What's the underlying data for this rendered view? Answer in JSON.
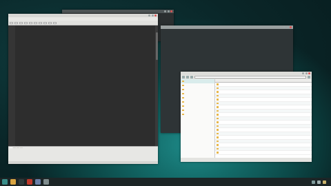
{
  "colors": {
    "desktop_teal": "#136b69",
    "editor_bg": "#2d2d2d",
    "terminal_bg": "#2e3436",
    "comment_green": "#8aa46b",
    "keyword_yellow": "#e0c070",
    "folder_orange": "#e7b64a",
    "close_red": "#dd5555"
  },
  "back_window": {
    "title": ""
  },
  "editor": {
    "title": "",
    "menu": [
      "",
      "",
      "",
      "",
      "",
      "",
      "",
      "",
      "",
      "",
      "",
      ""
    ],
    "toolbar": [
      "",
      "",
      "",
      "",
      "",
      "",
      "",
      "",
      "",
      ""
    ],
    "line_numbers": [
      "",
      "",
      "",
      "",
      "",
      "",
      "",
      "",
      "",
      "",
      "",
      "",
      "",
      "",
      "",
      "",
      "",
      "",
      "",
      "",
      "",
      "",
      "",
      "",
      "",
      "",
      "",
      "",
      "",
      "",
      "",
      "",
      "",
      "",
      "",
      "",
      "",
      "",
      "",
      "",
      ""
    ],
    "code_lines": [
      {
        "text": "",
        "cls": "c-comment"
      },
      {
        "text": "",
        "cls": "c-comment"
      },
      {
        "text": "",
        "cls": "c-comment"
      },
      {
        "text": "",
        "cls": "c-comment"
      },
      {
        "text": "",
        "cls": "c-comment"
      },
      {
        "text": "",
        "cls": "c-comment"
      },
      {
        "text": "",
        "cls": "c-comment"
      },
      {
        "text": "",
        "cls": "c-plain"
      },
      {
        "text": "",
        "cls": "c-plain"
      },
      {
        "text": "",
        "cls": "c-keyword"
      },
      {
        "text": "",
        "cls": "c-keyword"
      },
      {
        "text": "",
        "cls": "c-plain"
      },
      {
        "text": "",
        "cls": "c-plain"
      },
      {
        "text": "",
        "cls": "c-plain"
      },
      {
        "text": "",
        "cls": "c-keyword"
      },
      {
        "text": "",
        "cls": "c-keyword"
      },
      {
        "text": "",
        "cls": "c-plain"
      },
      {
        "text": "",
        "cls": "c-plain"
      },
      {
        "text": "",
        "cls": "c-keyword"
      },
      {
        "text": "",
        "cls": "c-keyword"
      },
      {
        "text": "",
        "cls": "c-plain"
      },
      {
        "text": "",
        "cls": "c-plain"
      },
      {
        "text": "",
        "cls": "c-keyword"
      },
      {
        "text": "",
        "cls": "c-plain"
      },
      {
        "text": "",
        "cls": "c-keyword"
      },
      {
        "text": "",
        "cls": "c-plain"
      },
      {
        "text": "",
        "cls": "c-plain"
      },
      {
        "text": "",
        "cls": "c-fn"
      },
      {
        "text": "",
        "cls": "c-fn"
      },
      {
        "text": "",
        "cls": "c-fn"
      },
      {
        "text": "",
        "cls": "c-fn"
      },
      {
        "text": "",
        "cls": "c-plain"
      },
      {
        "text": "",
        "cls": "c-plain"
      },
      {
        "text": "",
        "cls": "c-plain"
      },
      {
        "text": "",
        "cls": "c-fn"
      },
      {
        "text": "",
        "cls": "c-fn"
      },
      {
        "text": "",
        "cls": "c-fn"
      },
      {
        "text": "",
        "cls": "c-fn"
      },
      {
        "text": "",
        "cls": "c-plain"
      },
      {
        "text": "",
        "cls": "c-plain"
      }
    ],
    "bottom_tabs": [
      "",
      "",
      "",
      ""
    ],
    "messages": [
      "",
      ""
    ],
    "status": ""
  },
  "terminal": {
    "title": "",
    "lines": [
      {
        "text": "",
        "cls": ""
      },
      {
        "text": "",
        "cls": ""
      },
      {
        "text": "",
        "cls": ""
      },
      {
        "text": "",
        "cls": ""
      },
      {
        "text": "",
        "cls": ""
      },
      {
        "text": "",
        "cls": ""
      },
      {
        "text": "",
        "cls": ""
      },
      {
        "text": "",
        "cls": ""
      },
      {
        "text": "",
        "cls": ""
      },
      {
        "text": "",
        "cls": ""
      },
      {
        "text": "",
        "cls": ""
      },
      {
        "text": "",
        "cls": ""
      },
      {
        "text": "",
        "cls": ""
      },
      {
        "text": "",
        "cls": ""
      },
      {
        "text": "",
        "cls": ""
      },
      {
        "text": "",
        "cls": ""
      },
      {
        "text": "",
        "cls": ""
      },
      {
        "text": "",
        "cls": "t-green"
      },
      {
        "text": "",
        "cls": "t-green"
      },
      {
        "text": "",
        "cls": "t-green"
      },
      {
        "text": "",
        "cls": "t-blue"
      },
      {
        "text": "",
        "cls": "t-blue"
      },
      {
        "text": "",
        "cls": ""
      },
      {
        "text": "",
        "cls": ""
      }
    ]
  },
  "file_manager": {
    "title": "",
    "path": "",
    "tree": [
      {
        "label": "",
        "selected": true
      },
      {
        "label": "",
        "selected": false
      },
      {
        "label": "",
        "selected": false
      },
      {
        "label": "",
        "selected": false
      },
      {
        "label": "",
        "selected": false
      },
      {
        "label": "",
        "selected": false
      },
      {
        "label": "",
        "selected": false
      },
      {
        "label": "",
        "selected": false
      },
      {
        "label": "",
        "selected": false
      }
    ],
    "columns": [
      "",
      "",
      ""
    ],
    "rows": [
      {
        "name": "",
        "size": "",
        "type": ""
      },
      {
        "name": "",
        "size": "",
        "type": ""
      },
      {
        "name": "",
        "size": "",
        "type": ""
      },
      {
        "name": "",
        "size": "",
        "type": ""
      },
      {
        "name": "",
        "size": "",
        "type": ""
      },
      {
        "name": "",
        "size": "",
        "type": ""
      },
      {
        "name": "",
        "size": "",
        "type": ""
      },
      {
        "name": "",
        "size": "",
        "type": ""
      },
      {
        "name": "",
        "size": "",
        "type": ""
      },
      {
        "name": "",
        "size": "",
        "type": ""
      },
      {
        "name": "",
        "size": "",
        "type": ""
      },
      {
        "name": "",
        "size": "",
        "type": ""
      },
      {
        "name": "",
        "size": "",
        "type": ""
      },
      {
        "name": "",
        "size": "",
        "type": ""
      },
      {
        "name": "",
        "size": "",
        "type": ""
      },
      {
        "name": "",
        "size": "",
        "type": ""
      },
      {
        "name": "",
        "size": "",
        "type": ""
      },
      {
        "name": "",
        "size": "",
        "type": ""
      },
      {
        "name": "",
        "size": "",
        "type": ""
      }
    ],
    "status": ""
  },
  "watermark": {
    "line1": "",
    "line2": ""
  },
  "taskbar": {
    "apps": [
      {
        "icon": "start-menu-icon",
        "color": "#3a8e8a"
      },
      {
        "icon": "file-manager-icon",
        "color": "#d9a441"
      },
      {
        "icon": "terminal-icon",
        "color": "#2f3b3c"
      },
      {
        "icon": "browser-icon",
        "color": "#c0392b"
      },
      {
        "icon": "editor-icon",
        "color": "#6a7fa8"
      },
      {
        "icon": "settings-icon",
        "color": "#7f8c8d"
      }
    ],
    "tray": [
      {
        "icon": "network-icon",
        "color": "#7f9a9a"
      },
      {
        "icon": "volume-icon",
        "color": "#9fb0b0"
      },
      {
        "icon": "battery-icon",
        "color": "#c9b26b"
      }
    ],
    "clock": ""
  }
}
